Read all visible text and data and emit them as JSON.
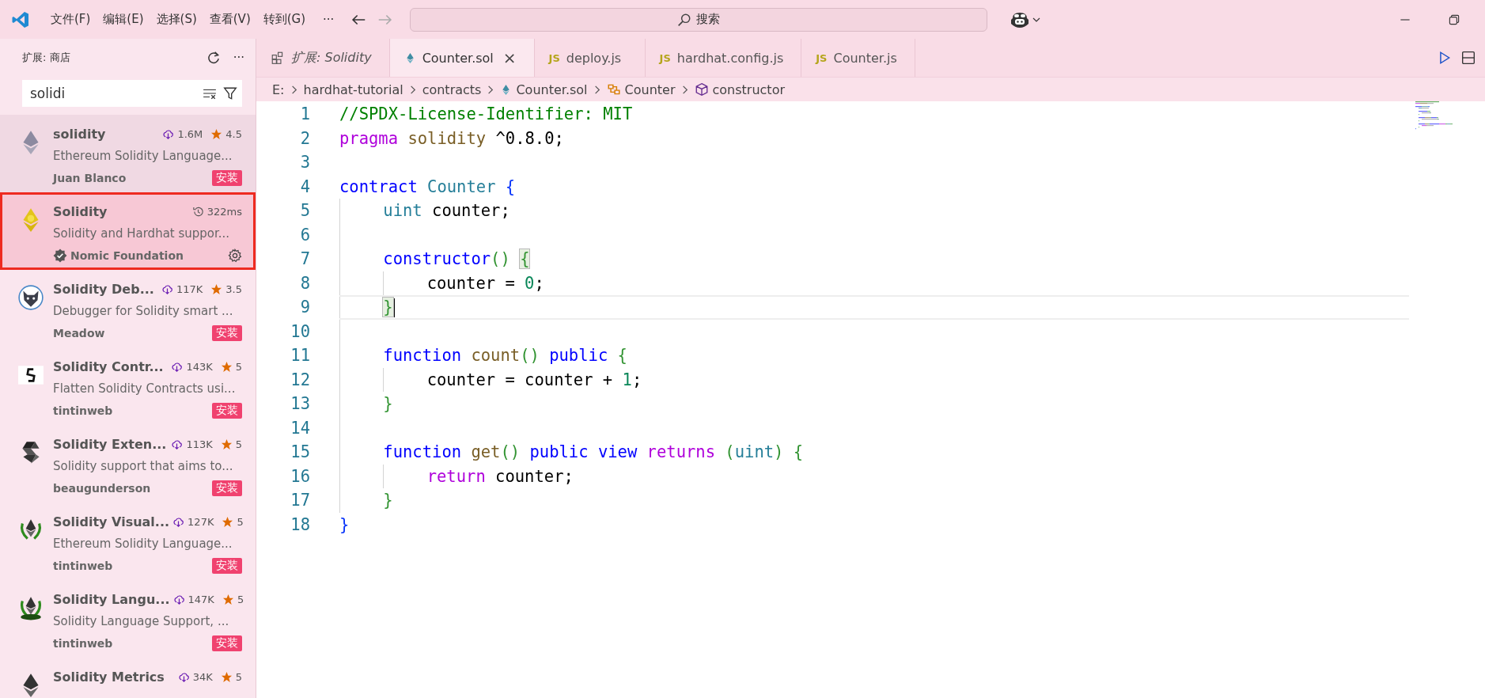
{
  "titlebar": {
    "menus": [
      "文件(F)",
      "编辑(E)",
      "选择(S)",
      "查看(V)",
      "转到(G)"
    ],
    "more": "···",
    "back_disabled": false,
    "forward_disabled": true,
    "search": "搜索"
  },
  "sidebar": {
    "title": "扩展: 商店",
    "more": "···",
    "search": {
      "value": "solidi"
    },
    "items": [
      {
        "name": "solidity",
        "kind": "eth-gray",
        "downloads": "1.6M",
        "rating": "4.5",
        "description": "Ethereum Solidity Language...",
        "publisher": "Juan Blanco",
        "verified": false,
        "install": "安装",
        "selected": false,
        "focused": true
      },
      {
        "name": "Solidity",
        "kind": "eth-gold",
        "time": "322ms",
        "description": "Solidity and Hardhat suppor...",
        "publisher": "Nomic Foundation",
        "verified": true,
        "settings": true,
        "selected": true,
        "focused": false
      },
      {
        "name": "Solidity Deb...",
        "kind": "fox",
        "downloads": "117K",
        "rating": "3.5",
        "description": "Debugger for Solidity smart ...",
        "publisher": "Meadow",
        "verified": false,
        "install": "安装",
        "selected": false,
        "focused": false
      },
      {
        "name": "Solidity Contr...",
        "kind": "s-mark",
        "downloads": "143K",
        "rating": "5",
        "description": "Flatten Solidity Contracts usi...",
        "publisher": "tintinweb",
        "verified": false,
        "install": "安装",
        "selected": false,
        "focused": false
      },
      {
        "name": "Solidity Exten...",
        "kind": "s-dark",
        "downloads": "113K",
        "rating": "5",
        "description": "Solidity support that aims to...",
        "publisher": "beaugunderson",
        "verified": false,
        "install": "安装",
        "selected": false,
        "focused": false
      },
      {
        "name": "Solidity Visual...",
        "kind": "eth-laurel",
        "downloads": "127K",
        "rating": "5",
        "description": "Ethereum Solidity Language...",
        "publisher": "tintinweb",
        "verified": false,
        "install": "安装",
        "selected": false,
        "focused": false
      },
      {
        "name": "Solidity Langu...",
        "kind": "eth-laurel-badge",
        "downloads": "147K",
        "rating": "5",
        "description": "Solidity Language Support, ...",
        "publisher": "tintinweb",
        "verified": false,
        "install": "安装",
        "selected": false,
        "focused": false
      },
      {
        "name": "Solidity Metrics",
        "kind": "eth-dark",
        "downloads": "34K",
        "rating": "5",
        "selected": false,
        "focused": false
      }
    ]
  },
  "tabs": [
    {
      "label": "扩展: Solidity",
      "kind": "extension",
      "preview": true,
      "selected": false
    },
    {
      "label": "Counter.sol",
      "kind": "sol",
      "preview": false,
      "selected": true,
      "close": "×"
    },
    {
      "label": "deploy.js",
      "kind": "js",
      "badge": "JS",
      "preview": false,
      "selected": false
    },
    {
      "label": "hardhat.config.js",
      "kind": "js",
      "badge": "JS",
      "preview": false,
      "selected": false
    },
    {
      "label": "Counter.js",
      "kind": "js",
      "badge": "JS",
      "preview": false,
      "selected": false
    }
  ],
  "breadcrumb": [
    {
      "label": "E:",
      "kind": "folder"
    },
    {
      "label": "hardhat-tutorial",
      "kind": "folder"
    },
    {
      "label": "contracts",
      "kind": "folder"
    },
    {
      "label": "Counter.sol",
      "kind": "sol"
    },
    {
      "label": "Counter",
      "kind": "class"
    },
    {
      "label": "constructor",
      "kind": "method"
    }
  ],
  "code": [
    {
      "n": "1",
      "tokens": [
        {
          "text": "//SPDX-License-Identifier: MIT",
          "kind": "comment"
        }
      ]
    },
    {
      "n": "2",
      "tokens": [
        {
          "text": "pragma",
          "kind": "control"
        },
        {
          "text": " solidity",
          "kind": "name"
        },
        {
          "text": " ^0.8.0;",
          "kind": "plain"
        }
      ]
    },
    {
      "n": "3"
    },
    {
      "n": "4",
      "tokens": [
        {
          "text": "contract",
          "kind": "keyword"
        },
        {
          "text": " Counter",
          "kind": "type"
        },
        {
          "text": " {",
          "kind": "b1"
        }
      ],
      "children": [
        {
          "n": "5",
          "tokens": [
            {
              "text": "uint",
              "kind": "type"
            },
            {
              "text": " counter;",
              "kind": "plain"
            }
          ]
        },
        {
          "n": "6"
        },
        {
          "n": "7",
          "tokens": [
            {
              "text": "constructor",
              "kind": "keyword"
            },
            {
              "text": "() ",
              "kind": "b2"
            },
            {
              "text": "{",
              "kind": "b2",
              "match": true
            }
          ],
          "children": [
            {
              "n": "8",
              "tokens": [
                {
                  "text": "counter = ",
                  "kind": "plain"
                },
                {
                  "text": "0",
                  "kind": "num"
                },
                {
                  "text": ";",
                  "kind": "plain"
                }
              ]
            }
          ]
        },
        {
          "n": "9",
          "current": true,
          "tokens": [
            {
              "text": "}",
              "kind": "b2",
              "match": true,
              "caret": true
            }
          ]
        },
        {
          "n": "10"
        },
        {
          "n": "11",
          "tokens": [
            {
              "text": "function",
              "kind": "keyword"
            },
            {
              "text": " count",
              "kind": "func"
            },
            {
              "text": "()",
              "kind": "b2"
            },
            {
              "text": " public",
              "kind": "keyword"
            },
            {
              "text": " {",
              "kind": "b2"
            }
          ],
          "children": [
            {
              "n": "12",
              "tokens": [
                {
                  "text": "counter = counter + ",
                  "kind": "plain"
                },
                {
                  "text": "1",
                  "kind": "num"
                },
                {
                  "text": ";",
                  "kind": "plain"
                }
              ]
            }
          ]
        },
        {
          "n": "13",
          "tokens": [
            {
              "text": "}",
              "kind": "b2"
            }
          ]
        },
        {
          "n": "14"
        },
        {
          "n": "15",
          "tokens": [
            {
              "text": "function",
              "kind": "keyword"
            },
            {
              "text": " get",
              "kind": "func"
            },
            {
              "text": "()",
              "kind": "b2"
            },
            {
              "text": " public",
              "kind": "keyword"
            },
            {
              "text": " view",
              "kind": "keyword"
            },
            {
              "text": " returns",
              "kind": "control"
            },
            {
              "text": " (",
              "kind": "b2"
            },
            {
              "text": "uint",
              "kind": "type"
            },
            {
              "text": ")",
              "kind": "b2"
            },
            {
              "text": " {",
              "kind": "b2"
            }
          ],
          "children": [
            {
              "n": "16",
              "tokens": [
                {
                  "text": "return",
                  "kind": "control"
                },
                {
                  "text": " counter;",
                  "kind": "plain"
                }
              ]
            }
          ]
        },
        {
          "n": "17",
          "tokens": [
            {
              "text": "}",
              "kind": "b2"
            }
          ]
        }
      ]
    },
    {
      "n": "18",
      "tokens": [
        {
          "text": "}",
          "kind": "b1"
        }
      ]
    }
  ]
}
